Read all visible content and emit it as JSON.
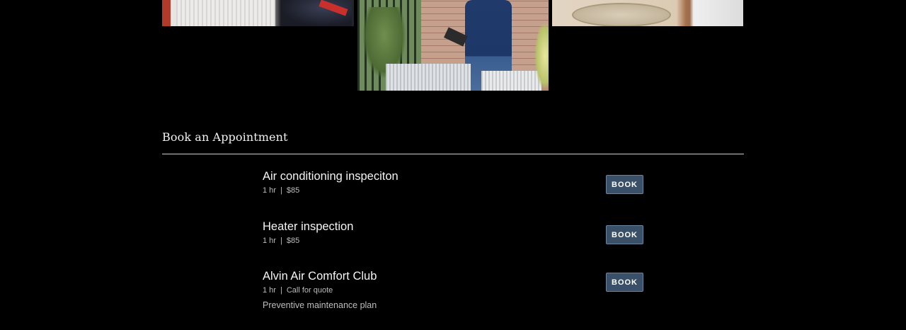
{
  "booking": {
    "title": "Book an Appointment",
    "services": [
      {
        "name": "Air conditioning inspeciton",
        "duration": "1 hr",
        "separator": "|",
        "price": "$85",
        "button_label": "BOOK"
      },
      {
        "name": "Heater inspection",
        "duration": "1 hr",
        "separator": "|",
        "price": "$85",
        "button_label": "BOOK"
      },
      {
        "name": "Alvin Air Comfort Club",
        "duration": "1 hr",
        "separator": "|",
        "price": "Call for quote",
        "description": "Preventive maintenance plan",
        "button_label": "BOOK"
      }
    ]
  },
  "colors": {
    "background": "#000000",
    "button": "#3a5068",
    "divider": "#cfcfcf"
  }
}
